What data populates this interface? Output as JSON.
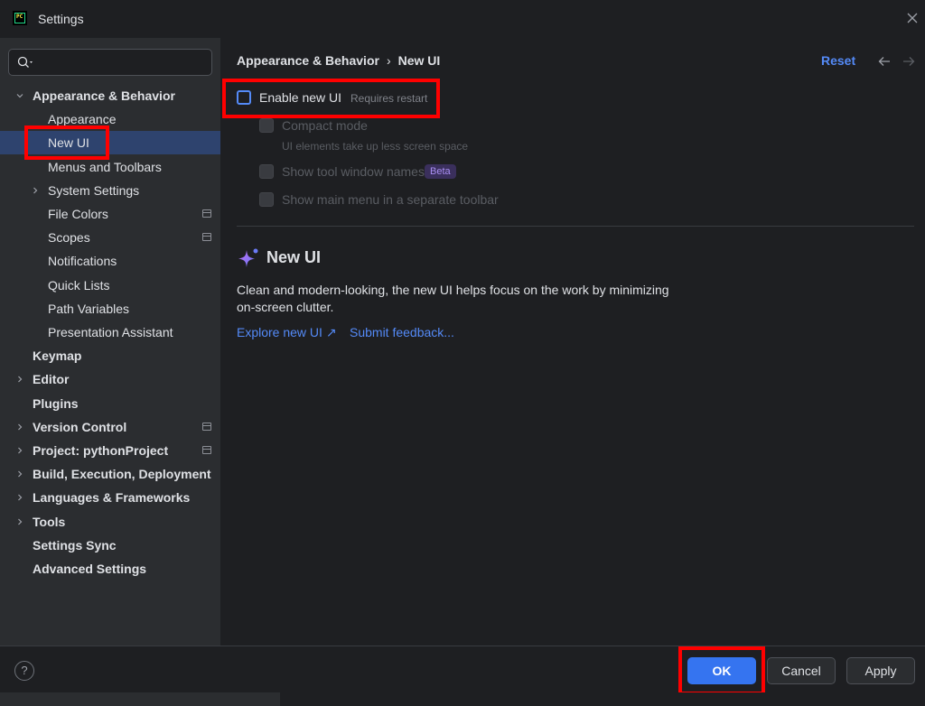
{
  "window": {
    "title": "Settings",
    "app_icon": "pycharm-icon",
    "close_icon": "close-icon"
  },
  "sidebar": {
    "search_placeholder": "",
    "items": [
      {
        "label": "Appearance & Behavior",
        "level": 0,
        "expanded": true,
        "bold": true
      },
      {
        "label": "Appearance",
        "level": 1
      },
      {
        "label": "New UI",
        "level": 1,
        "selected": true
      },
      {
        "label": "Menus and Toolbars",
        "level": 1
      },
      {
        "label": "System Settings",
        "level": 1,
        "expandable": true
      },
      {
        "label": "File Colors",
        "level": 1,
        "project_icon": true
      },
      {
        "label": "Scopes",
        "level": 1,
        "project_icon": true
      },
      {
        "label": "Notifications",
        "level": 1
      },
      {
        "label": "Quick Lists",
        "level": 1
      },
      {
        "label": "Path Variables",
        "level": 1
      },
      {
        "label": "Presentation Assistant",
        "level": 1
      },
      {
        "label": "Keymap",
        "level": 0,
        "bold": true
      },
      {
        "label": "Editor",
        "level": 0,
        "bold": true,
        "expandable": true
      },
      {
        "label": "Plugins",
        "level": 0,
        "bold": true
      },
      {
        "label": "Version Control",
        "level": 0,
        "bold": true,
        "expandable": true,
        "project_icon": true
      },
      {
        "label": "Project: pythonProject",
        "level": 0,
        "bold": true,
        "expandable": true,
        "project_icon": true
      },
      {
        "label": "Build, Execution, Deployment",
        "level": 0,
        "bold": true,
        "expandable": true
      },
      {
        "label": "Languages & Frameworks",
        "level": 0,
        "bold": true,
        "expandable": true
      },
      {
        "label": "Tools",
        "level": 0,
        "bold": true,
        "expandable": true
      },
      {
        "label": "Settings Sync",
        "level": 0,
        "bold": true
      },
      {
        "label": "Advanced Settings",
        "level": 0,
        "bold": true
      }
    ]
  },
  "content": {
    "breadcrumb_parent": "Appearance & Behavior",
    "breadcrumb_sep": "›",
    "breadcrumb_current": "New UI",
    "reset_label": "Reset",
    "options": {
      "enable_new_ui": {
        "label": "Enable new UI",
        "hint": "Requires restart",
        "checked": false,
        "enabled": true
      },
      "compact_mode": {
        "label": "Compact mode",
        "hint": "UI elements take up less screen space",
        "checked": false,
        "enabled": false
      },
      "tool_window_names": {
        "label": "Show tool window names",
        "badge": "Beta",
        "checked": false,
        "enabled": false
      },
      "main_menu_toolbar": {
        "label": "Show main menu in a separate toolbar",
        "checked": false,
        "enabled": false
      }
    },
    "promo": {
      "icon": "sparkle-icon",
      "title": "New UI",
      "description": "Clean and modern-looking, the new UI helps focus on the work by minimizing on-screen clutter.",
      "explore_link": "Explore new UI ↗",
      "feedback_link": "Submit feedback..."
    }
  },
  "footer": {
    "help_label": "?",
    "ok_label": "OK",
    "cancel_label": "Cancel",
    "apply_label": "Apply"
  },
  "colors": {
    "accent": "#548af7",
    "ok_button": "#3574f0",
    "selection": "#2e436e",
    "annotation": "#ff0000"
  }
}
